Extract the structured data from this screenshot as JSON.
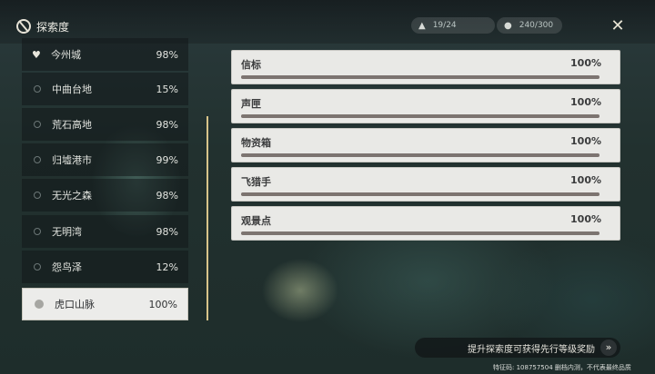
{
  "header": {
    "title": "探索度",
    "pills": [
      {
        "icon": "mountain-icon",
        "value": "19/24"
      },
      {
        "icon": "orb-icon",
        "value": "240/300"
      }
    ]
  },
  "regions": [
    {
      "name": "今州城",
      "pct": "98%",
      "marker": "heart"
    },
    {
      "name": "中曲台地",
      "pct": "15%"
    },
    {
      "name": "荒石高地",
      "pct": "98%"
    },
    {
      "name": "归墟港市",
      "pct": "99%"
    },
    {
      "name": "无光之森",
      "pct": "98%"
    },
    {
      "name": "无明湾",
      "pct": "98%"
    },
    {
      "name": "怨鸟泽",
      "pct": "12%"
    },
    {
      "name": "虎口山脉",
      "pct": "100%",
      "selected": true
    }
  ],
  "categories": [
    {
      "name": "信标",
      "pct": "100%",
      "progress": 1.0
    },
    {
      "name": "声匣",
      "pct": "100%",
      "progress": 1.0
    },
    {
      "name": "物资箱",
      "pct": "100%",
      "progress": 1.0
    },
    {
      "name": "飞猎手",
      "pct": "100%",
      "progress": 1.0
    },
    {
      "name": "观景点",
      "pct": "100%",
      "progress": 1.0
    }
  ],
  "reward": {
    "text": "提升探索度可获得先行等级奖励",
    "button": "»"
  },
  "footer": "特征码: 108757504   删档内测，不代表最终品质",
  "colors": {
    "accent": "#d8c48a",
    "panel": "#e9e9e6",
    "fill": "#7c7470"
  }
}
